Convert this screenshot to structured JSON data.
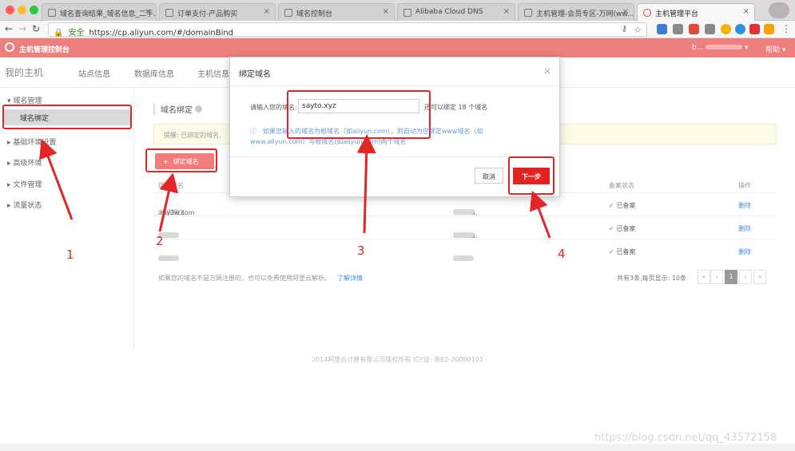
{
  "browser": {
    "tabs": [
      {
        "label": "域名查询结果_域名信息_二手..."
      },
      {
        "label": "订单支付-产品购买"
      },
      {
        "label": "域名控制台"
      },
      {
        "label": "Alibaba Cloud DNS"
      },
      {
        "label": "主机管理-会员专区-万网(ww..."
      },
      {
        "label": "主机管理平台"
      }
    ],
    "secure_label": "安全",
    "url": "https://cp.aliyun.com/#/domainBind"
  },
  "console": {
    "title": "主机管理控制台",
    "user": "b...",
    "help": "帮助"
  },
  "page_tabs": {
    "my_host": "我的主机",
    "site_info": "站点信息",
    "db_info": "数据库信息",
    "host_info": "主机信息"
  },
  "sidebar": {
    "domain_mgmt": "域名管理",
    "domain_bind": "域名绑定",
    "basic_env": "基础环境设置",
    "advanced_env": "高级环境",
    "file_mgmt": "文件管理",
    "traffic_status": "流量状态"
  },
  "main": {
    "title": "域名绑定",
    "notice": "提醒: 已绑定的域名,",
    "bind_button": "绑定域名",
    "col_domain": "绑定域名",
    "col_status": "备案状态",
    "col_action": "操作",
    "rows": [
      {
        "domain": "bx...123",
        "domain_tail": ".my3w.com",
        "ip": "60.205.",
        "status": "已备案",
        "action": "删除"
      },
      {
        "domain": "sa",
        "domain_tail": "",
        "ip": "60.205.",
        "status": "已备案",
        "action": "删除"
      },
      {
        "domain": "ww",
        "domain_tail": "",
        "ip": "60.20",
        "status": "已备案",
        "action": "删除"
      }
    ],
    "footer_note": "如果您的域名不是万网注册的，也可以免费使用阿里云解析。",
    "footer_link": "了解详情",
    "pager_info": "共有3条,每页显示: 10条",
    "pager_current": "1"
  },
  "modal": {
    "title": "绑定域名",
    "close": "×",
    "input_label": "请输入您的域名:",
    "input_value": "sayto.xyz",
    "quota": "还可以绑定 18 个域名",
    "tip": "ⓘ　如果您输入的域名为根域名（如aliyun.com），则自动为您绑定www域名（如www.aliyun.com）与根域名(如aliyun.com)两个域名",
    "cancel": "取消",
    "next": "下一步"
  },
  "annotations": {
    "n1": "1",
    "n2": "2",
    "n3": "3",
    "n4": "4"
  },
  "copyright": "2014阿里云计算有限公司版权所有 ICP证: 浙B2-20080101",
  "watermark": "https://blog.csdn.net/qq_43572158",
  "colors": {
    "console_bar": "#ee7f7f",
    "annotation_red": "#e22626",
    "next_button": "#e32222",
    "link_blue": "#4a8fd4"
  }
}
